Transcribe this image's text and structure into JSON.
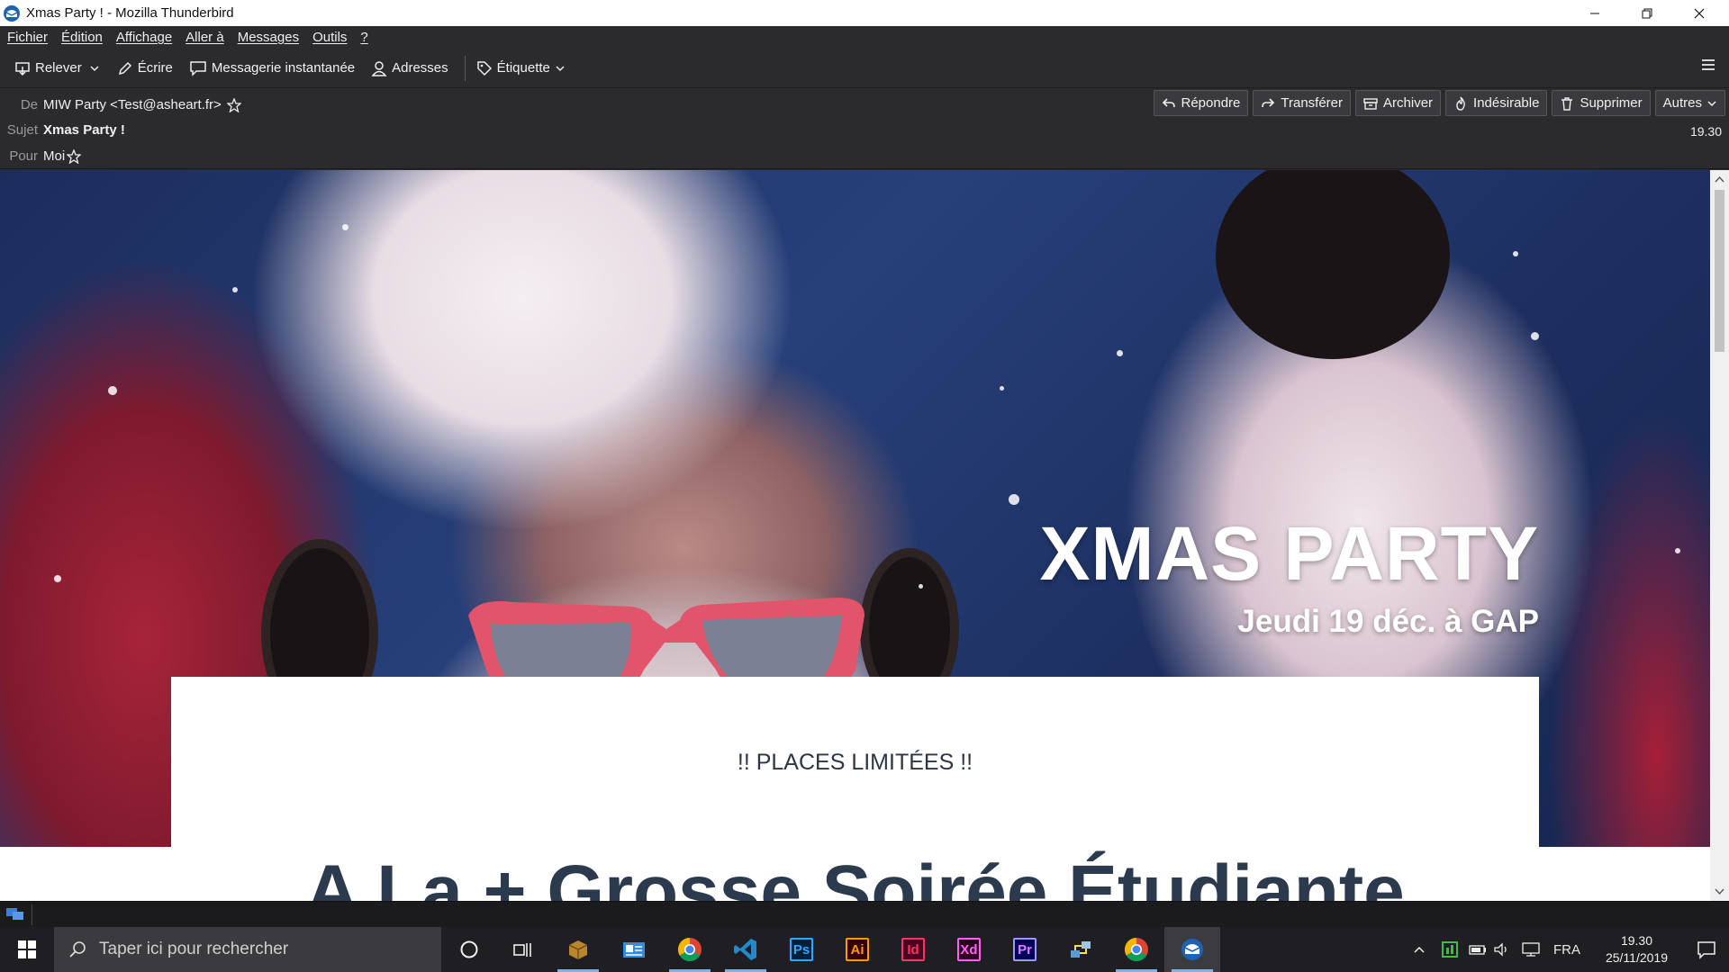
{
  "window": {
    "title": "Xmas Party ! - Mozilla Thunderbird"
  },
  "menu": [
    "Fichier",
    "Édition",
    "Affichage",
    "Aller à",
    "Messages",
    "Outils",
    "?"
  ],
  "toolbar": {
    "get_mail": "Relever",
    "write": "Écrire",
    "chat": "Messagerie instantanée",
    "address_book": "Adresses",
    "tag": "Étiquette"
  },
  "header": {
    "from_label": "De",
    "from_value": "MIW Party <Test@asheart.fr>",
    "subject_label": "Sujet",
    "subject_value": "Xmas Party !",
    "to_label": "Pour",
    "to_value": "Moi",
    "time": "19.30",
    "actions": {
      "reply": "Répondre",
      "forward": "Transférer",
      "archive": "Archiver",
      "junk": "Indésirable",
      "delete": "Supprimer",
      "other": "Autres"
    }
  },
  "message": {
    "hero_title": "XMAS PARTY",
    "hero_subtitle": "Jeudi 19 déc. à GAP",
    "notice": "!! PLACES LIMITÉES !!",
    "heading": "A La + Grosse Soirée Étudiante"
  },
  "taskbar": {
    "search_placeholder": "Taper ici pour rechercher",
    "language": "FRA",
    "time": "19.30",
    "date": "25/11/2019",
    "apps": [
      "cortana",
      "task-view",
      "package",
      "file-explorer",
      "chrome",
      "vscode",
      "photoshop",
      "illustrator",
      "indesign",
      "xd",
      "premiere",
      "network-tool",
      "chrome",
      "thunderbird"
    ]
  },
  "colors": {
    "toolbar_bg": "#2b2b2e",
    "body_bg": "#ffffff",
    "hero_blue": "#27407a",
    "santa_red": "#a7243a",
    "heading_text": "#2c3a4e",
    "taskbar_bg": "#1f1f23"
  }
}
